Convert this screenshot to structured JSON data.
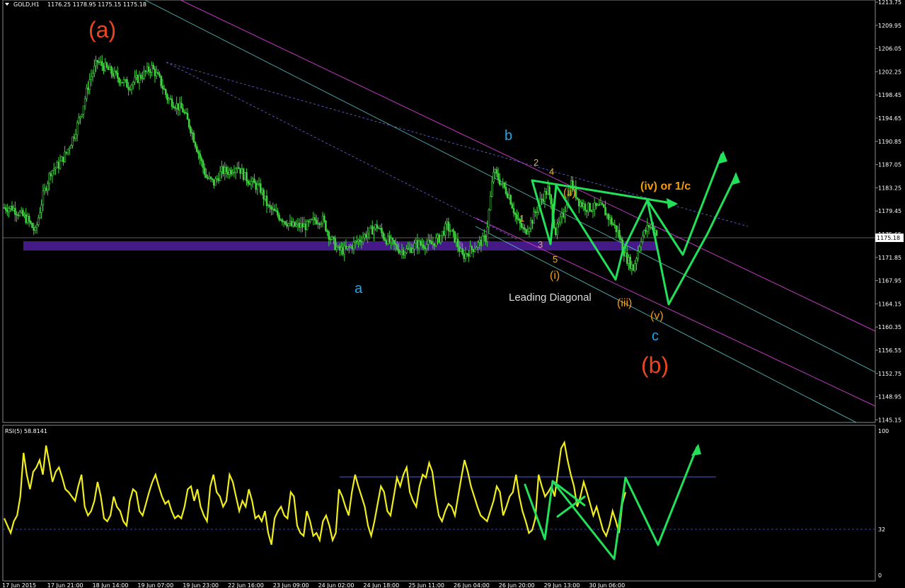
{
  "header": {
    "symbol_timeframe": "GOLD,H1",
    "ohlc": "1176.25 1178.95 1175.15 1175.18"
  },
  "chart_data": [
    {
      "type": "candlestick",
      "title": "GOLD,H1",
      "price_ticks": [
        "1213.75",
        "1209.95",
        "1206.05",
        "1202.25",
        "1198.45",
        "1194.65",
        "1190.85",
        "1187.05",
        "1183.25",
        "1179.45",
        "1175.65",
        "1171.85",
        "1167.95",
        "1164.15",
        "1160.35",
        "1156.55",
        "1152.75",
        "1148.95",
        "1145.15"
      ],
      "current_price": "1175.18",
      "time_labels": [
        "17 Jun 2015",
        "17 Jun 21:00",
        "18 Jun 14:00",
        "19 Jun 07:00",
        "19 Jun 23:00",
        "22 Jun 16:00",
        "23 Jun 09:00",
        "24 Jun 02:00",
        "24 Jun 18:00",
        "25 Jun 11:00",
        "26 Jun 04:00",
        "26 Jun 20:00",
        "29 Jun 13:00",
        "30 Jun 06:00"
      ],
      "close_path": [
        1180,
        1180,
        1179,
        1178,
        1176,
        1182,
        1186,
        1187,
        1189,
        1192,
        1196,
        1201,
        1204,
        1203,
        1202,
        1201,
        1200,
        1201,
        1202,
        1203,
        1201,
        1198,
        1197,
        1196,
        1193,
        1189,
        1185,
        1184,
        1186,
        1186,
        1187,
        1185,
        1184,
        1183,
        1180,
        1179,
        1178,
        1177,
        1177,
        1177,
        1178,
        1178,
        1175,
        1173,
        1173,
        1174,
        1175,
        1176,
        1177,
        1175,
        1174,
        1173,
        1173,
        1174,
        1174,
        1174,
        1175,
        1177,
        1175,
        1172,
        1173,
        1174,
        1175,
        1186,
        1184,
        1182,
        1178,
        1176,
        1178,
        1181,
        1183,
        1176,
        1179,
        1184,
        1181,
        1180,
        1180,
        1180,
        1178,
        1176,
        1172,
        1170,
        1175,
        1177,
        1176
      ],
      "swing_labels": [
        {
          "text": "(a)",
          "price": 1208,
          "color": "#e8461e"
        },
        {
          "text": "a",
          "price": 1167,
          "color": "#1ea7f0"
        },
        {
          "text": "b",
          "price": 1191,
          "color": "#1ea7f0"
        },
        {
          "text": "c",
          "price": 1160,
          "color": "#1ea7f0"
        },
        {
          "text": "(b)",
          "price": 1154,
          "color": "#e8461e"
        }
      ],
      "wave_labels": [
        {
          "text": "2",
          "color": "#e8b434"
        },
        {
          "text": "4",
          "color": "#e8b434"
        },
        {
          "text": "1",
          "color": "#e8b434"
        },
        {
          "text": "3",
          "color": "#e8b434"
        },
        {
          "text": "5",
          "color": "#e8b434"
        },
        {
          "text": "(i)",
          "color": "#f39c12"
        },
        {
          "text": "(ii)",
          "color": "#f39c12"
        },
        {
          "text": "(iii)",
          "color": "#f39c12"
        },
        {
          "text": "(iv) or 1/c",
          "color": "#f39c12"
        },
        {
          "text": "(v)",
          "color": "#f39c12"
        }
      ],
      "annotation": "Leading Diagonal",
      "support_zone": [
        1173.6,
        1175.1
      ]
    },
    {
      "type": "line",
      "title": "RSI(5) 58.8141",
      "ylim": [
        0,
        100
      ],
      "ticks": [
        "100",
        "32",
        "0"
      ],
      "levels": [
        32,
        68
      ],
      "values": [
        40,
        35,
        30,
        38,
        42,
        55,
        85,
        70,
        60,
        72,
        75,
        80,
        70,
        90,
        78,
        65,
        72,
        75,
        68,
        60,
        58,
        55,
        52,
        62,
        70,
        48,
        42,
        45,
        52,
        65,
        55,
        40,
        38,
        42,
        55,
        48,
        45,
        38,
        35,
        52,
        60,
        58,
        45,
        42,
        50,
        58,
        65,
        70,
        62,
        55,
        50,
        52,
        45,
        40,
        42,
        40,
        48,
        60,
        62,
        52,
        60,
        48,
        42,
        38,
        62,
        70,
        58,
        55,
        48,
        52,
        70,
        65,
        55,
        45,
        52,
        48,
        60,
        52,
        40,
        42,
        38,
        45,
        30,
        22,
        40,
        45,
        48,
        42,
        40,
        58,
        55,
        35,
        30,
        28,
        45,
        38,
        28,
        30,
        25,
        38,
        42,
        35,
        25,
        30,
        60,
        55,
        48,
        42,
        58,
        70,
        62,
        55,
        48,
        35,
        28,
        38,
        50,
        62,
        58,
        45,
        42,
        55,
        68,
        62,
        70,
        75,
        58,
        52,
        48,
        62,
        70,
        68,
        78,
        72,
        55,
        42,
        38,
        45,
        50,
        48,
        42,
        55,
        68,
        80,
        72,
        62,
        55,
        48,
        42,
        40,
        38,
        45,
        52,
        62,
        58,
        42,
        48,
        55,
        58,
        70,
        55,
        45,
        38,
        30,
        32,
        40,
        70,
        62,
        55,
        58,
        62,
        55,
        72,
        88,
        92,
        80,
        70,
        62,
        48,
        55,
        65,
        58,
        50,
        42,
        48,
        40,
        32,
        28,
        35,
        45,
        38,
        30,
        50,
        58
      ]
    }
  ]
}
